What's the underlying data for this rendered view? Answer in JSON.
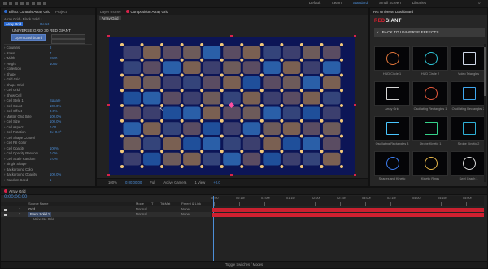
{
  "topbar": {
    "items": [
      "Default",
      "Learn",
      "Standard",
      "Small Screen",
      "Libraries"
    ]
  },
  "effect_controls": {
    "tabs": [
      "Effect Controls Array Grid",
      "Project"
    ],
    "comp_label": "Array Grid · Black Solid 1",
    "effect_name": "Array Grid",
    "header_button": "Reset",
    "section_title": "UNIVERSE GRID 30 RED GIANT",
    "open_dashboard": "Open Dashboard",
    "rows": [
      {
        "label": "Columns",
        "value": "8"
      },
      {
        "label": "Rows",
        "value": "7"
      },
      {
        "label": "Width",
        "value": "1920"
      },
      {
        "label": "Height",
        "value": "1080"
      },
      {
        "label": "Collection",
        "value": ""
      },
      {
        "label": "Shape",
        "value": ""
      },
      {
        "label": "Grid Grid",
        "value": ""
      },
      {
        "label": "Shape Grid",
        "value": ""
      },
      {
        "label": "Cell Grid",
        "value": ""
      },
      {
        "label": "Show Cell",
        "value": ""
      },
      {
        "label": "Cell Style 1",
        "value": "Square"
      },
      {
        "label": "Cell Count",
        "value": "100.0%"
      },
      {
        "label": "Cell Offset",
        "value": "0.0%"
      },
      {
        "label": "Master Grid Size",
        "value": "100.0%"
      },
      {
        "label": "Cell Size",
        "value": "100.0%"
      },
      {
        "label": "Cell Aspect",
        "value": "0.00"
      },
      {
        "label": "Cell Rotation",
        "value": "0x+0.0°"
      },
      {
        "label": "Cell Shape Control",
        "value": ""
      },
      {
        "label": "Cell Fill Color",
        "value": ""
      },
      {
        "label": "Cell Opacity",
        "value": "100%"
      },
      {
        "label": "Cell Opacity Random",
        "value": "0.0%"
      },
      {
        "label": "Cell Scale Random",
        "value": "0.0%"
      },
      {
        "label": "Single Shape",
        "value": ""
      },
      {
        "label": "Background Color",
        "value": ""
      },
      {
        "label": "Background Opacity",
        "value": "100.0%"
      },
      {
        "label": "Random Seed",
        "value": "1"
      }
    ]
  },
  "composition": {
    "tabs": [
      "Layer (none)",
      "Composition Array Grid"
    ],
    "breadcrumb": "Array Grid",
    "footer": [
      "100%",
      "Full",
      "Active Camera",
      "1 View",
      "+0.0"
    ],
    "timecode": "0:00:00:00"
  },
  "dashboard": {
    "title": "RG Universe Dashboard",
    "brand_red": "RED",
    "brand_white": "GIANT",
    "back_label": "BACK TO UNIVERSE EFFECTS",
    "thumbnails": [
      "HUD Circle 1",
      "HUD Circle 2",
      "Video Triangles",
      "Array Grid",
      "Oscillating Rectangles 1",
      "Oscillating Rectangles 2",
      "Oscillating Rectangles 3",
      "Strobe Kinetic 1",
      "Strobe Kinetic 2",
      "Shapes and Kinetic",
      "Kinetic Rings",
      "Swirl Graph 1"
    ]
  },
  "timeline": {
    "tab": "Array Grid",
    "timecode": "0:00:00:00",
    "column_headers": [
      "Source Name",
      "Mode",
      "T",
      "TrkMat",
      "Parent & Link"
    ],
    "layers": [
      {
        "num": "1",
        "name": "Grid",
        "mode": "Normal",
        "parent": "None"
      },
      {
        "num": "2",
        "name": "Black Solid 1",
        "mode": "Normal",
        "parent": "None"
      }
    ],
    "sublayer": "Universe Grid",
    "ruler": [
      "00:00",
      "00:15f",
      "01:00f",
      "01:15f",
      "02:00f",
      "02:15f",
      "03:00f",
      "03:15f",
      "04:00f",
      "04:15f",
      "05:00f"
    ],
    "footer_label": "Toggle Switches / Modes"
  },
  "grid": {
    "columns": 11,
    "rows": 8,
    "palette": [
      "#3c3f6e",
      "#5a4c62",
      "#7a6052",
      "#2a5fa8",
      "#34447a",
      "#6d5b5a",
      "#1f4f9a"
    ],
    "cells": [
      [
        0,
        2,
        1,
        5,
        3,
        1,
        2,
        4,
        0,
        5,
        1
      ],
      [
        4,
        1,
        3,
        2,
        0,
        5,
        1,
        3,
        2,
        0,
        3
      ],
      [
        2,
        5,
        0,
        4,
        1,
        2,
        6,
        1,
        5,
        3,
        2
      ],
      [
        6,
        3,
        1,
        0,
        5,
        4,
        2,
        0,
        1,
        2,
        4
      ],
      [
        1,
        0,
        6,
        3,
        2,
        1,
        5,
        3,
        4,
        6,
        0
      ],
      [
        3,
        2,
        4,
        1,
        6,
        0,
        3,
        5,
        2,
        1,
        5
      ],
      [
        5,
        4,
        2,
        6,
        3,
        4,
        0,
        2,
        6,
        3,
        1
      ],
      [
        0,
        6,
        5,
        2,
        4,
        3,
        1,
        6,
        0,
        4,
        2
      ]
    ],
    "bg": "#0c1556",
    "point_color": "#f3c97a"
  },
  "accent_red": "#c8202f",
  "accent_blue": "#4c8ed8"
}
